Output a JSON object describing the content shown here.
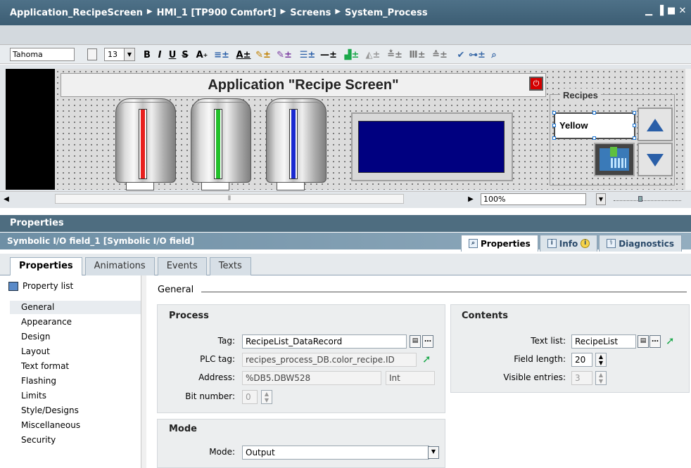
{
  "titlebar": {
    "crumbs": [
      "Application_RecipeScreen",
      "HMI_1 [TP900 Comfort]",
      "Screens",
      "System_Process"
    ],
    "window_controls": [
      "minimize-icon",
      "restore-icon",
      "maximize-icon",
      "close-icon"
    ]
  },
  "toolbar": {
    "font": "Tahoma",
    "size": "13",
    "bold": "B",
    "italic": "I",
    "underline": "U",
    "strike": "S",
    "superscript": "A",
    "font_color": "A"
  },
  "screen": {
    "title": "Application \"Recipe Screen\"",
    "tanks": [
      {
        "name": "tank-red",
        "color": "#e8201e"
      },
      {
        "name": "tank-green",
        "color": "#22c02a"
      },
      {
        "name": "tank-blue",
        "color": "#1a2ad0"
      }
    ],
    "recipes_label": "Recipes",
    "recipe_value": "Yellow",
    "zoom": "100%"
  },
  "properties_panel": {
    "header": "Properties",
    "object": "Symbolic I/O field_1 [Symbolic I/O field]",
    "top_tabs": [
      {
        "label": "Properties",
        "icon": "properties-icon"
      },
      {
        "label": "Info",
        "icon": "info-icon"
      },
      {
        "label": "Diagnostics",
        "icon": "diagnostics-icon"
      }
    ],
    "sub_tabs": [
      "Properties",
      "Animations",
      "Events",
      "Texts"
    ],
    "property_list_label": "Property list",
    "nav": [
      "General",
      "Appearance",
      "Design",
      "Layout",
      "Text format",
      "Flashing",
      "Limits",
      "Style/Designs",
      "Miscellaneous",
      "Security"
    ],
    "general_label": "General",
    "process": {
      "title": "Process",
      "tag_label": "Tag:",
      "tag_value": "RecipeList_DataRecord",
      "plc_tag_label": "PLC tag:",
      "plc_tag_value": "recipes_process_DB.color_recipe.ID",
      "address_label": "Address:",
      "address_value": "%DB5.DBW528",
      "address_type": "Int",
      "bit_number_label": "Bit number:",
      "bit_number_value": "0"
    },
    "contents": {
      "title": "Contents",
      "text_list_label": "Text list:",
      "text_list_value": "RecipeList",
      "field_length_label": "Field length:",
      "field_length_value": "20",
      "visible_entries_label": "Visible entries:",
      "visible_entries_value": "3"
    },
    "mode": {
      "title": "Mode",
      "mode_label": "Mode:",
      "mode_value": "Output"
    }
  }
}
